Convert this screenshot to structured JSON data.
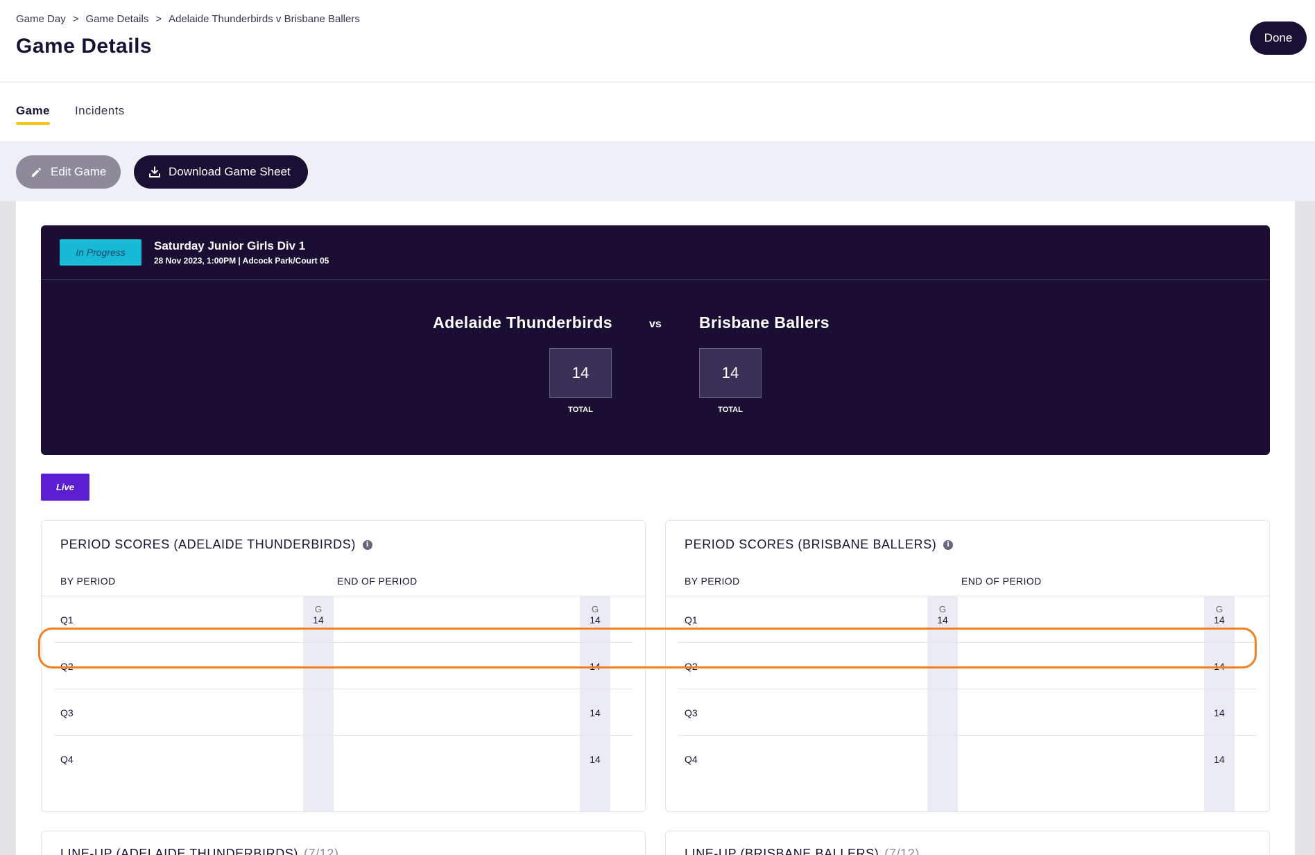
{
  "breadcrumb": [
    "Game Day",
    "Game Details",
    "Adelaide Thunderbirds v Brisbane Ballers"
  ],
  "breadcrumb_sep": ">",
  "page_title": "Game Details",
  "done_label": "Done",
  "tabs": [
    {
      "label": "Game",
      "active": true
    },
    {
      "label": "Incidents",
      "active": false
    }
  ],
  "actions": {
    "edit_label": "Edit Game",
    "download_label": "Download Game Sheet"
  },
  "game": {
    "status": "In Progress",
    "competition": "Saturday Junior Girls Div 1",
    "meta": "28 Nov 2023, 1:00PM | Adcock Park/Court 05",
    "home_team": "Adelaide Thunderbirds",
    "away_team": "Brisbane Ballers",
    "vs": "vs",
    "home_score": "14",
    "away_score": "14",
    "total_label": "TOTAL"
  },
  "live_label": "Live",
  "period_panels": [
    {
      "title": "PERIOD SCORES (ADELAIDE THUNDERBIRDS)",
      "by_period": "BY PERIOD",
      "end_of_period": "END OF PERIOD",
      "g_label": "G",
      "rows": [
        {
          "period": "Q1",
          "by": "14",
          "end": "14"
        },
        {
          "period": "Q2",
          "by": "",
          "end": "14"
        },
        {
          "period": "Q3",
          "by": "",
          "end": "14"
        },
        {
          "period": "Q4",
          "by": "",
          "end": "14"
        }
      ]
    },
    {
      "title": "PERIOD SCORES (BRISBANE BALLERS)",
      "by_period": "BY PERIOD",
      "end_of_period": "END OF PERIOD",
      "g_label": "G",
      "rows": [
        {
          "period": "Q1",
          "by": "14",
          "end": "14"
        },
        {
          "period": "Q2",
          "by": "",
          "end": "14"
        },
        {
          "period": "Q3",
          "by": "",
          "end": "14"
        },
        {
          "period": "Q4",
          "by": "",
          "end": "14"
        }
      ]
    }
  ],
  "lineups": [
    {
      "title": "LINE-UP (ADELAIDE THUNDERBIRDS)",
      "count": "(7/12)"
    },
    {
      "title": "LINE-UP (BRISBANE BALLERS)",
      "count": "(7/12)"
    }
  ],
  "colors": {
    "highlight": "#f08020",
    "status_badge": "#17b9d6",
    "live_badge": "#5a1fd0",
    "tab_underline": "#f5c518",
    "card_bg": "#1a0f33"
  }
}
